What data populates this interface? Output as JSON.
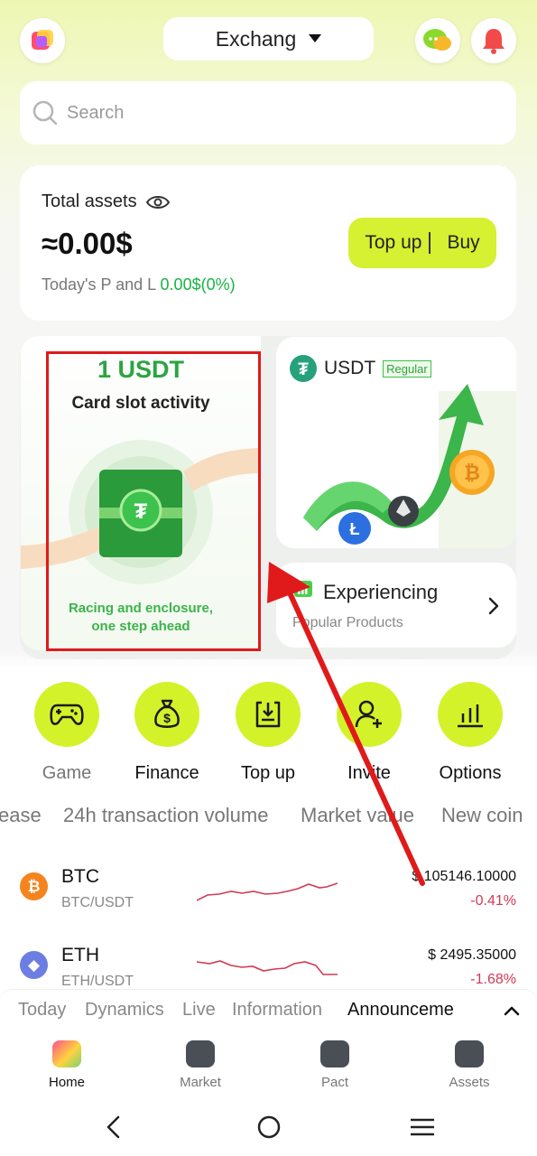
{
  "header": {
    "exchange_label": "Exchang",
    "search_placeholder": "Search"
  },
  "assets": {
    "label": "Total assets",
    "amount": "≈0.00$",
    "pl_label": "Today's P and L",
    "pl_value": "0.00$(0%)",
    "topup_label": "Top up",
    "buy_label": "Buy"
  },
  "banner": {
    "title": "1 USDT",
    "subtitle": "Card slot activity",
    "footer_line1": "Racing and enclosure,",
    "footer_line2": "one step ahead"
  },
  "usdt_card": {
    "coin": "USDT",
    "badge": "Regular"
  },
  "experience_card": {
    "title": "Experiencing",
    "subtitle": "Popular Products"
  },
  "quick_actions": [
    {
      "label": "Game",
      "icon": "gamepad-icon"
    },
    {
      "label": "Finance",
      "icon": "money-bag-icon"
    },
    {
      "label": "Top up",
      "icon": "deposit-icon"
    },
    {
      "label": "Invite",
      "icon": "add-user-icon"
    },
    {
      "label": "Options",
      "icon": "bar-chart-icon"
    }
  ],
  "market_tabs": [
    "ease",
    "24h transaction volume",
    "Market value",
    "New coin"
  ],
  "coins": [
    {
      "name": "BTC",
      "pair": "BTC/USDT",
      "price": "$ 105146.10000",
      "change": "-0.41%",
      "color": "#f5841f",
      "symbol": "₿"
    },
    {
      "name": "ETH",
      "pair": "ETH/USDT",
      "price": "$ 2495.35000",
      "change": "-1.68%",
      "color": "#6c7ee1",
      "symbol": "◆"
    }
  ],
  "news_tabs": [
    "Today",
    "Dynamics",
    "Live",
    "Information",
    "Announceme"
  ],
  "bottom_nav": [
    "Home",
    "Market",
    "Pact",
    "Assets"
  ],
  "colors": {
    "accent": "#d4f22a",
    "positive": "#17b344",
    "negative": "#d23a55",
    "annotation": "#e01a1a"
  }
}
